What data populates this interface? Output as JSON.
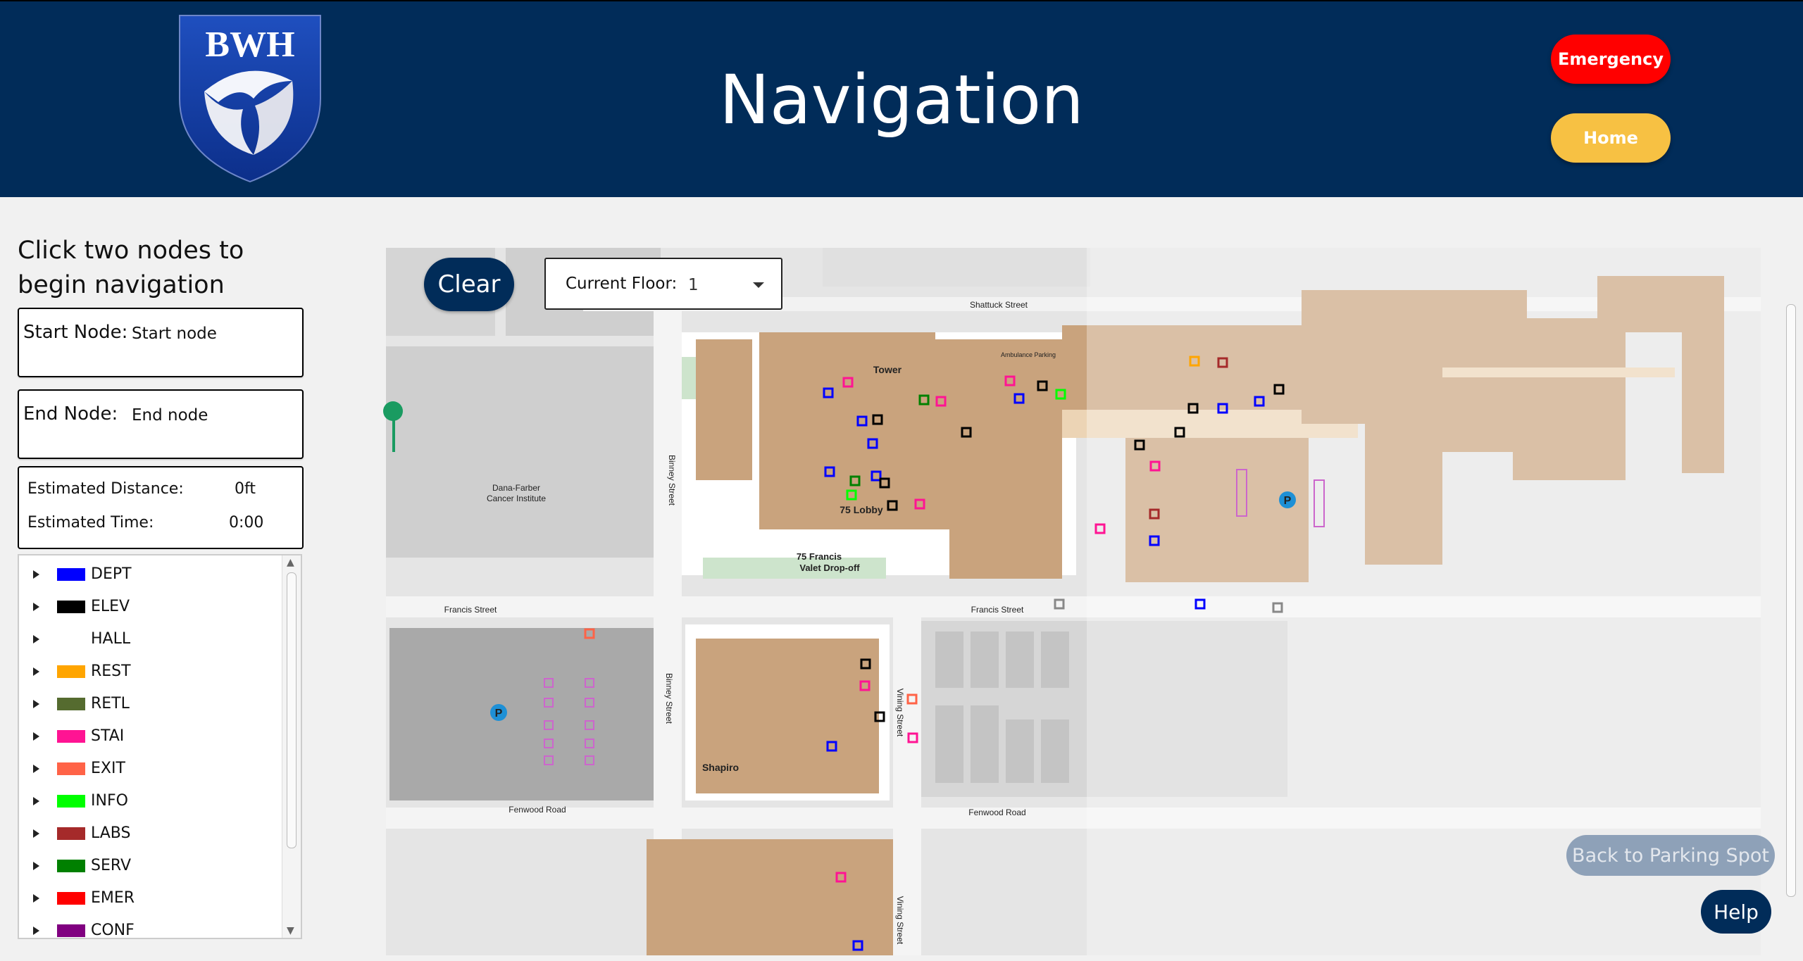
{
  "header": {
    "logo_text": "BWH",
    "title": "Navigation",
    "emergency_label": "Emergency",
    "home_label": "Home"
  },
  "panel": {
    "instructions": "Click two nodes to begin navigation",
    "start_label": "Start Node:",
    "start_value": "Start node",
    "end_label": "End Node:",
    "end_value": "End node",
    "distance_label": "Estimated Distance:",
    "distance_value": "0ft",
    "time_label": "Estimated Time:",
    "time_value": "0:00"
  },
  "legend": [
    {
      "name": "DEPT",
      "color": "#0000ff"
    },
    {
      "name": "ELEV",
      "color": "#000000"
    },
    {
      "name": "HALL",
      "color": "#ffffff"
    },
    {
      "name": "REST",
      "color": "#ffa500"
    },
    {
      "name": "RETL",
      "color": "#556b2f"
    },
    {
      "name": "STAI",
      "color": "#ff1493"
    },
    {
      "name": "EXIT",
      "color": "#ff6347"
    },
    {
      "name": "INFO",
      "color": "#00ff00"
    },
    {
      "name": "LABS",
      "color": "#a52a2a"
    },
    {
      "name": "SERV",
      "color": "#008000"
    },
    {
      "name": "EMER",
      "color": "#ff0000"
    },
    {
      "name": "CONF",
      "color": "#800080"
    }
  ],
  "map": {
    "clear_label": "Clear",
    "floor_label": "Current Floor:",
    "floor_value": "1",
    "back_parking_label": "Back to Parking Spot",
    "help_label": "Help",
    "labels": {
      "shattuck": "Shattuck Street",
      "francis1": "Francis Street",
      "francis2": "Francis Street",
      "fenwood1": "Fenwood Road",
      "fenwood2": "Fenwood Road",
      "binney1": "Binney Street",
      "binney2": "Binney Street",
      "vining1": "Vining Street",
      "vining2": "Vining Street",
      "dana1": "Dana-Farber",
      "dana2": "Cancer Institute",
      "tower": "Tower",
      "lobby": "75 Lobby",
      "valet1": "75 Francis",
      "valet2": "Valet Drop-off",
      "shapiro": "Shapiro",
      "ambulance": "Ambulance Parking",
      "parking_p": "P"
    }
  }
}
